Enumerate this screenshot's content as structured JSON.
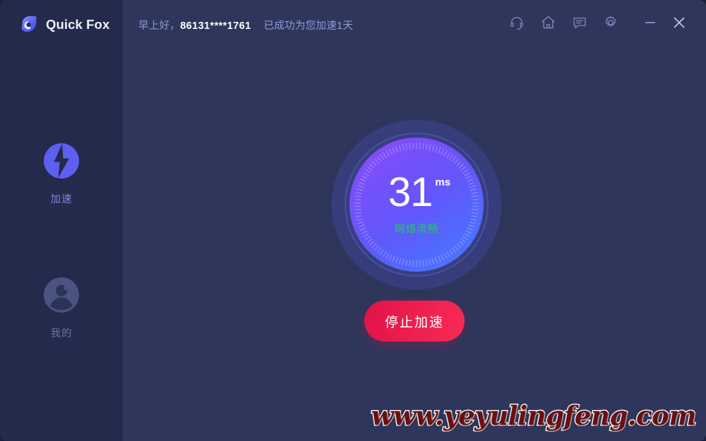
{
  "app": {
    "logo_text": "Quick Fox",
    "background_color": "#2e365c",
    "sidebar_color": "#232a4b"
  },
  "sidebar": {
    "items": [
      {
        "label": "加速",
        "icon": "lightning-circle-icon",
        "active": true
      },
      {
        "label": "我的",
        "icon": "user-avatar-icon",
        "active": false
      }
    ]
  },
  "header": {
    "greeting": "早上好，",
    "account": "86131****1761",
    "status_note": "已成功为您加速1天",
    "icons": [
      {
        "name": "headset-icon"
      },
      {
        "name": "home-icon"
      },
      {
        "name": "message-icon"
      },
      {
        "name": "gear-icon"
      }
    ],
    "window_controls": [
      {
        "name": "minimize-button",
        "glyph": "—"
      },
      {
        "name": "close-button",
        "glyph": "✕"
      }
    ]
  },
  "main": {
    "gauge": {
      "ping_value": "31",
      "ping_unit": "ms",
      "status_text": "网络流畅",
      "status_color": "#1fcf52"
    },
    "action_button": {
      "label": "停止加速",
      "color": "#ec1d4f"
    }
  },
  "watermark": {
    "text": "www.yeyulingfeng.com"
  }
}
